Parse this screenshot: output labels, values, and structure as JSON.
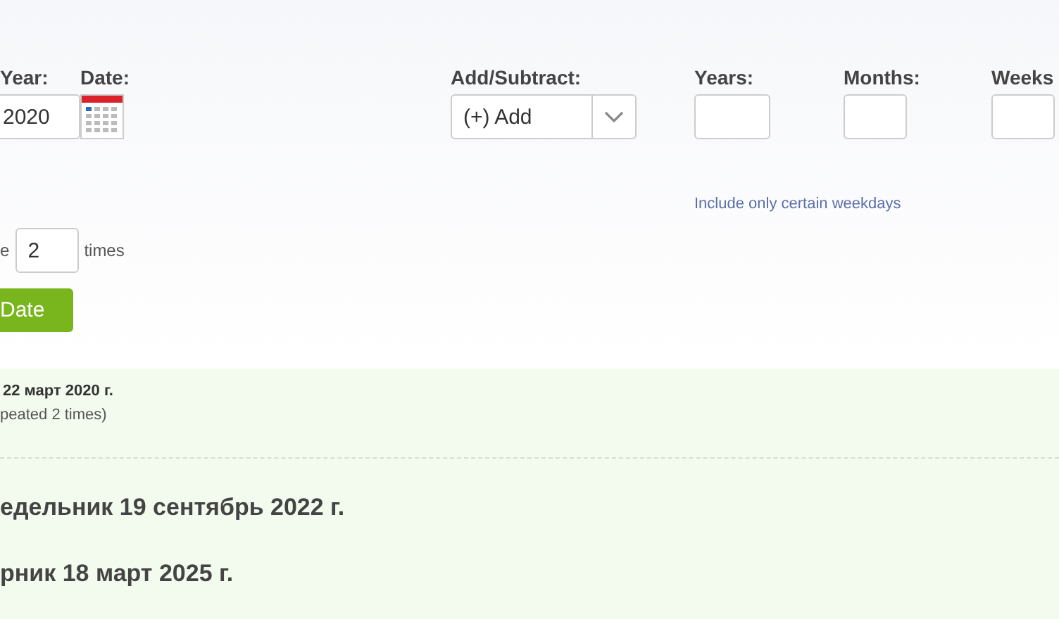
{
  "form": {
    "fields": [
      {
        "label": "Year:",
        "value": "2020",
        "kind": "year"
      },
      {
        "label": "Date:",
        "kind": "calendar"
      },
      {
        "label": "Add/Subtract:",
        "value": "(+) Add",
        "kind": "select"
      },
      {
        "label": "Years:",
        "kind": "number"
      },
      {
        "label": "Months:",
        "kind": "number"
      },
      {
        "label": "Weeks",
        "kind": "number"
      }
    ],
    "weekday_link": "Include only certain weekdays",
    "repeat": {
      "prefix": "e",
      "value": "2",
      "suffix": "times"
    },
    "submit": "Date"
  },
  "result": {
    "start": "22 март 2020 г.",
    "note": "peated 2 times)",
    "dates": [
      "едельник 19 сентябрь 2022 г.",
      "рник 18 март 2025 г."
    ]
  }
}
